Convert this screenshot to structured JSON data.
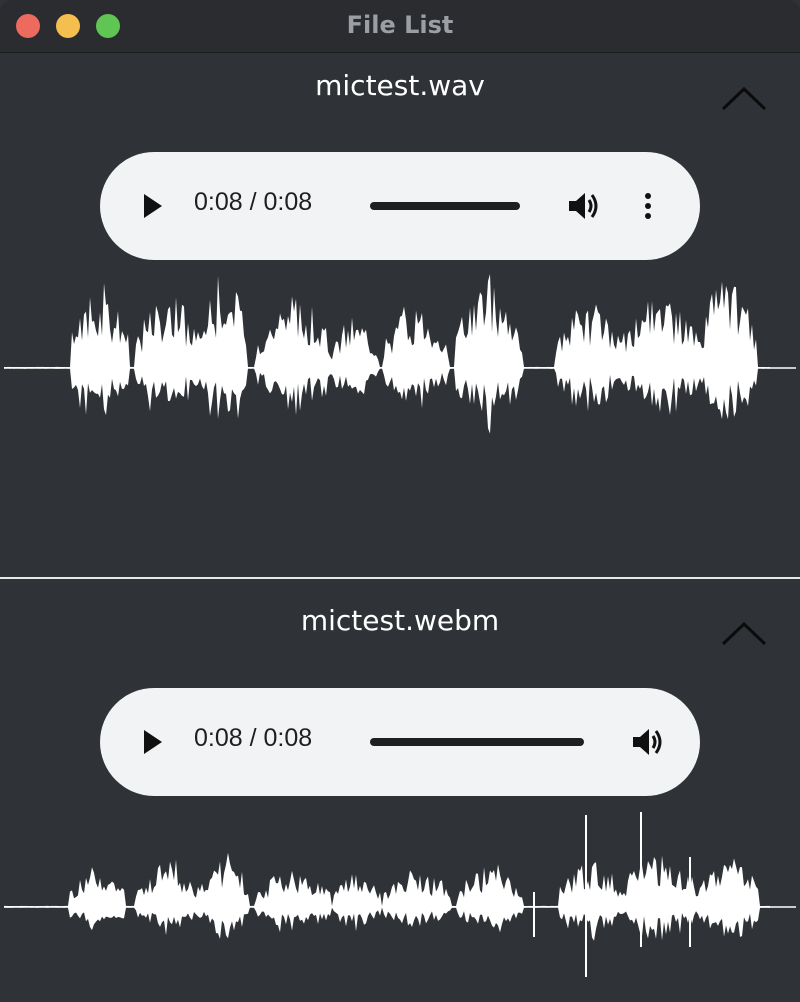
{
  "window": {
    "title": "File List"
  },
  "files": [
    {
      "name": "mictest.wav",
      "player": {
        "time": "0:08 / 0:08",
        "progress": 1.0,
        "has_more_menu": true
      },
      "collapse_icon": "chevron-up-icon"
    },
    {
      "name": "mictest.webm",
      "player": {
        "time": "0:08 / 0:08",
        "progress": 1.0,
        "has_more_menu": false
      },
      "collapse_icon": "chevron-up-icon"
    }
  ],
  "colors": {
    "background": "#2f3236",
    "player_background": "#f1f3f4",
    "waveform": "#ffffff"
  }
}
